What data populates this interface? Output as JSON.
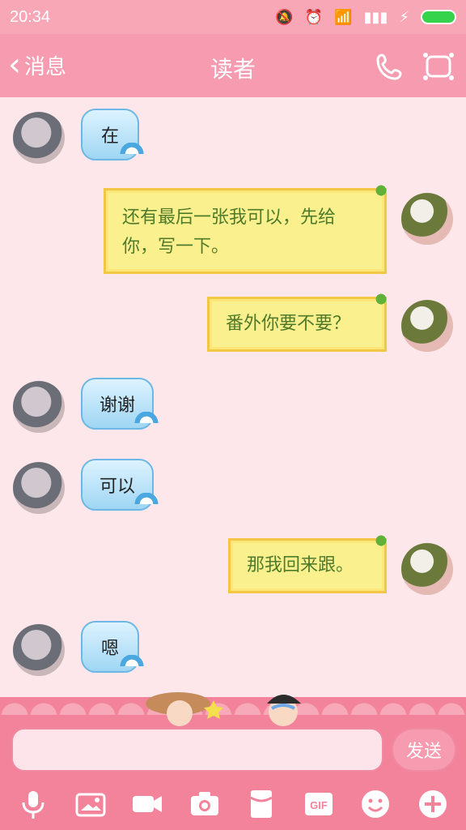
{
  "status_bar": {
    "time": "20:34"
  },
  "header": {
    "back_label": "消息",
    "title": "读者"
  },
  "messages": [
    {
      "side": "in",
      "text": "在"
    },
    {
      "side": "out",
      "text": "还有最后一张我可以，先给你，写一下。"
    },
    {
      "side": "out",
      "text": "番外你要不要？"
    },
    {
      "side": "in",
      "text": "谢谢"
    },
    {
      "side": "in",
      "text": "可以"
    },
    {
      "side": "out",
      "text": "那我回来跟。"
    },
    {
      "side": "in",
      "text": "嗯"
    }
  ],
  "composer": {
    "input_value": "",
    "send_label": "发送"
  },
  "toolbar": {
    "items": [
      "microphone-icon",
      "image-icon",
      "video-call-icon",
      "camera-icon",
      "red-packet-icon",
      "gif-icon",
      "emoji-icon",
      "plus-icon"
    ],
    "gif_label": "GIF"
  },
  "colors": {
    "header_bg": "#f69bb0",
    "page_bg": "#fde7ea",
    "bottom_bg": "#f3839b"
  }
}
